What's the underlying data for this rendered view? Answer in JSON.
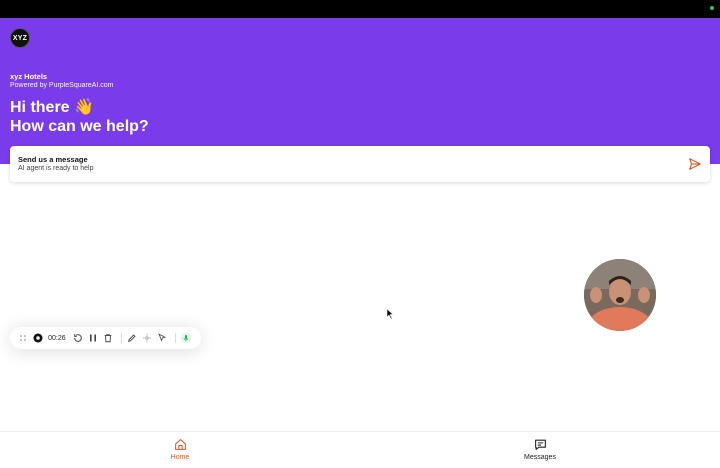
{
  "hero": {
    "logo_text": "XYZ",
    "brand": "xyz Hotels",
    "powered_by": "Powered by PurpleSquareAI.com",
    "greeting_line1": "Hi there 👋",
    "greeting_line2": "How can we help?"
  },
  "message_card": {
    "title": "Send us a message",
    "subtitle": "AI agent is ready to help"
  },
  "recorder": {
    "time": "00:26"
  },
  "bottom_nav": {
    "items": [
      {
        "label": "Home"
      },
      {
        "label": "Messages"
      }
    ]
  },
  "colors": {
    "brand_purple": "#7a3bea",
    "accent_orange": "#e05a2a",
    "mic_green": "#2eaa4a"
  }
}
